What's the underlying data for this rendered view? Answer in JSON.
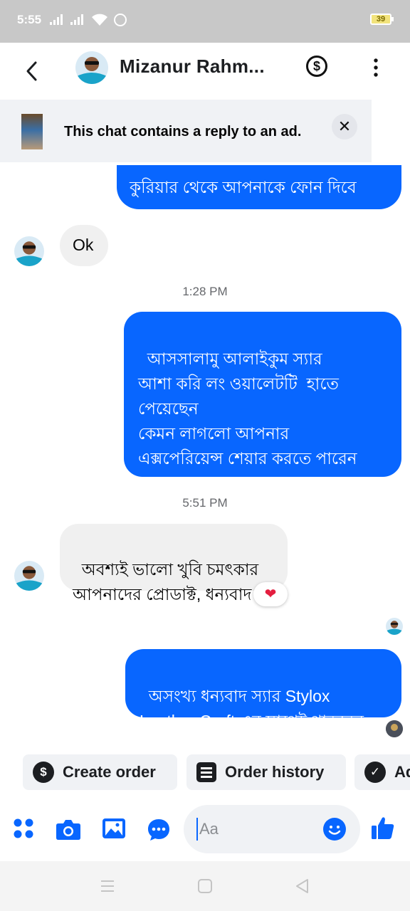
{
  "status_bar": {
    "time": "5:55",
    "battery": "39"
  },
  "header": {
    "contact_name": "Mizanur Rahm...",
    "payment_symbol": "$"
  },
  "ad_banner": {
    "text": "This chat contains a reply to an ad.",
    "close_symbol": "✕"
  },
  "messages": [
    {
      "kind": "outgoing",
      "text": "কুরিয়ার থেকে আপনাকে ফোন দিবে"
    },
    {
      "kind": "incoming",
      "text": "Ok"
    },
    {
      "kind": "timestamp",
      "text": "1:28 PM"
    },
    {
      "kind": "outgoing",
      "text": "আসসালামু আলাইকুম স্যার\nআশা করি লং ওয়ালেটটি  হাতে পেয়েছেন\nকেমন লাগলো আপনার\nএক্সপেরিয়েন্স শেয়ার করতে পারেন\nস্যার ভালো অথবা খারাপ"
    },
    {
      "kind": "timestamp",
      "text": "5:51 PM"
    },
    {
      "kind": "incoming",
      "text": "অবশ্যই ভালো খুবি চমৎকার\nআপনাদের প্রোডাক্ট, ধন্যবাদ",
      "reaction": "❤"
    },
    {
      "kind": "outgoing",
      "text": "অসংখ্য ধন্যবাদ স্যার Stylox\nLeather Craft এর সাথেই থাকবেন"
    }
  ],
  "quick_actions": [
    {
      "label": "Create order",
      "icon": "dollar-circle-icon"
    },
    {
      "label": "Order history",
      "icon": "receipt-icon"
    },
    {
      "label": "Ad",
      "icon": "check-circle-icon"
    }
  ],
  "composer": {
    "placeholder": "Aa"
  },
  "colors": {
    "accent": "#0866ff",
    "incoming_bubble": "#f0f0f0",
    "text": "#050505"
  }
}
